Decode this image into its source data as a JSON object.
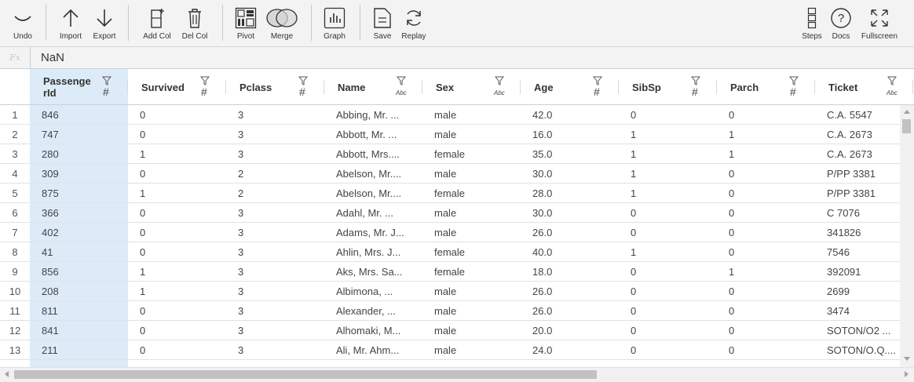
{
  "toolbar": {
    "undo": "Undo",
    "import": "Import",
    "export": "Export",
    "add_col": "Add Col",
    "del_col": "Del Col",
    "pivot": "Pivot",
    "merge": "Merge",
    "graph": "Graph",
    "save": "Save",
    "replay": "Replay",
    "steps": "Steps",
    "docs": "Docs",
    "fullscreen": "Fullscreen"
  },
  "formula_bar": {
    "label": "Fx",
    "value": "NaN"
  },
  "columns": [
    {
      "name": "Passenge rId",
      "line1": "Passenge",
      "line2": "rId",
      "type": "#"
    },
    {
      "name": "Survived",
      "type": "#"
    },
    {
      "name": "Pclass",
      "type": "#"
    },
    {
      "name": "Name",
      "type": "Abc"
    },
    {
      "name": "Sex",
      "type": "Abc"
    },
    {
      "name": "Age",
      "type": "#"
    },
    {
      "name": "SibSp",
      "type": "#"
    },
    {
      "name": "Parch",
      "type": "#"
    },
    {
      "name": "Ticket",
      "type": "Abc"
    }
  ],
  "rows": [
    [
      "1",
      "846",
      "0",
      "3",
      "Abbing, Mr. ...",
      "male",
      "42.0",
      "0",
      "0",
      "C.A. 5547"
    ],
    [
      "2",
      "747",
      "0",
      "3",
      "Abbott, Mr. ...",
      "male",
      "16.0",
      "1",
      "1",
      "C.A. 2673"
    ],
    [
      "3",
      "280",
      "1",
      "3",
      "Abbott, Mrs....",
      "female",
      "35.0",
      "1",
      "1",
      "C.A. 2673"
    ],
    [
      "4",
      "309",
      "0",
      "2",
      "Abelson, Mr....",
      "male",
      "30.0",
      "1",
      "0",
      "P/PP 3381"
    ],
    [
      "5",
      "875",
      "1",
      "2",
      "Abelson, Mr....",
      "female",
      "28.0",
      "1",
      "0",
      "P/PP 3381"
    ],
    [
      "6",
      "366",
      "0",
      "3",
      "Adahl, Mr. ...",
      "male",
      "30.0",
      "0",
      "0",
      "C 7076"
    ],
    [
      "7",
      "402",
      "0",
      "3",
      "Adams, Mr. J...",
      "male",
      "26.0",
      "0",
      "0",
      "341826"
    ],
    [
      "8",
      "41",
      "0",
      "3",
      "Ahlin, Mrs. J...",
      "female",
      "40.0",
      "1",
      "0",
      "7546"
    ],
    [
      "9",
      "856",
      "1",
      "3",
      "Aks, Mrs. Sa...",
      "female",
      "18.0",
      "0",
      "1",
      "392091"
    ],
    [
      "10",
      "208",
      "1",
      "3",
      "Albimona, ...",
      "male",
      "26.0",
      "0",
      "0",
      "2699"
    ],
    [
      "11",
      "811",
      "0",
      "3",
      "Alexander, ...",
      "male",
      "26.0",
      "0",
      "0",
      "3474"
    ],
    [
      "12",
      "841",
      "0",
      "3",
      "Alhomaki, M...",
      "male",
      "20.0",
      "0",
      "0",
      "SOTON/O2 ..."
    ],
    [
      "13",
      "211",
      "0",
      "3",
      "Ali, Mr. Ahm...",
      "male",
      "24.0",
      "0",
      "0",
      "SOTON/O.Q...."
    ]
  ]
}
